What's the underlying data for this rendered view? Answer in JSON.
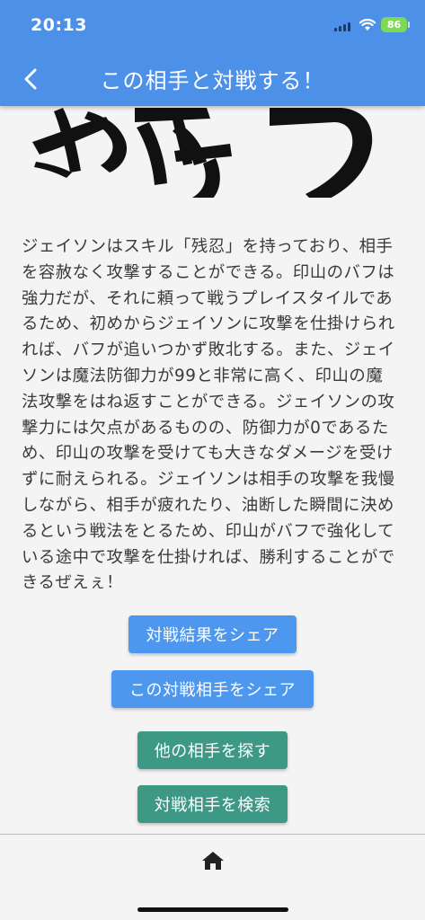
{
  "status_bar": {
    "time": "20:13",
    "battery": "86"
  },
  "header": {
    "title": "この相手と対戦する！"
  },
  "main": {
    "description": "ジェイソンはスキル「残忍」を持っており、相手\nを容赦なく攻撃することができる。印山のバフは\n強力だが、それに頼って戦うプレイスタイルであ\nるため、初めからジェイソンに攻撃を仕掛けられ\nれば、バフが追いつかず敗北する。また、ジェイ\nソンは魔法防御力が99と非常に高く、印山の魔\n法攻撃をはね返すことができる。ジェイソンの攻\n撃力には欠点があるものの、防御力が0であるた\nめ、印山の攻撃を受けても大きなダメージを受け\nずに耐えられる。ジェイソンは相手の攻撃を我慢\nしながら、相手が疲れたり、油断した瞬間に決め\nるという戦法をとるため、印山がバフで強化して\nいる途中で攻撃を仕掛ければ、勝利することがで\nきるぜえぇ！"
  },
  "actions": {
    "share_result": "対戦結果をシェア",
    "share_opponent": "この対戦相手をシェア",
    "find_other": "他の相手を探す",
    "search_opponent": "対戦相手を検索"
  },
  "colors": {
    "appbar": "#4d90e8",
    "button_blue": "#4d97ef",
    "button_green": "#3d9985",
    "battery": "#7ed957"
  },
  "icons": [
    "back-icon",
    "home-icon",
    "wifi-icon",
    "signal-icon"
  ]
}
